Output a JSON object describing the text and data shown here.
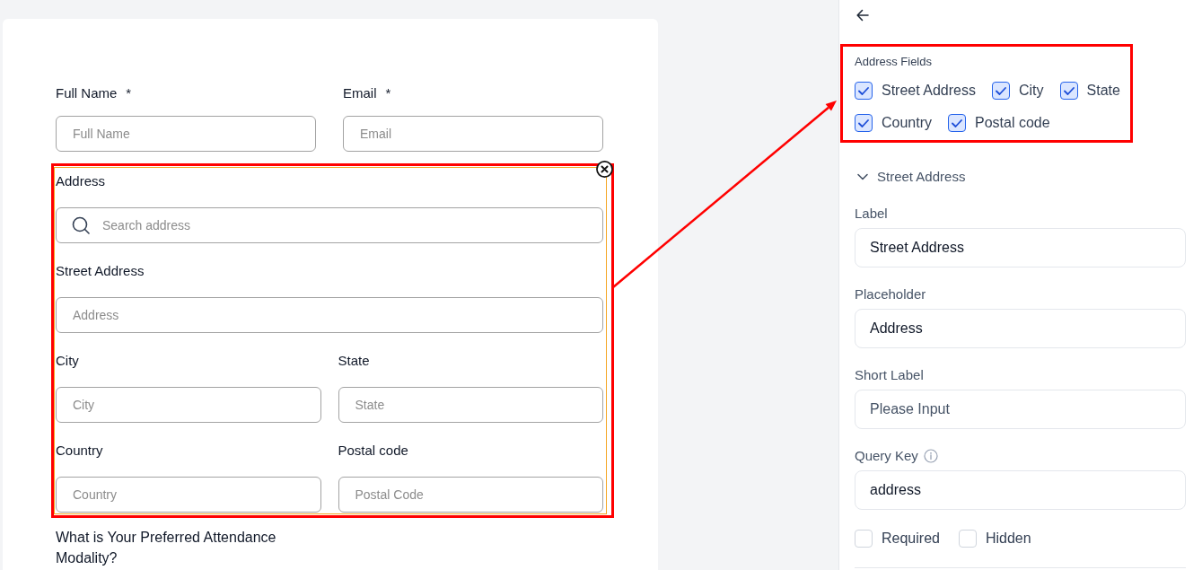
{
  "form": {
    "fields": [
      {
        "label": "Full Name",
        "mark": "*",
        "placeholder": "Full Name"
      },
      {
        "label": "Email",
        "mark": "*",
        "placeholder": "Email"
      }
    ],
    "address": {
      "selected": true,
      "title": "Address",
      "search": {
        "placeholder": "Search address"
      },
      "fields": [
        {
          "kind": "full",
          "label": "Street Address",
          "placeholder": "Address"
        },
        {
          "kind": "half",
          "label": "City",
          "placeholder": "City"
        },
        {
          "kind": "half",
          "label": "State",
          "placeholder": "State"
        },
        {
          "kind": "half",
          "label": "Country",
          "placeholder": "Country"
        },
        {
          "kind": "half",
          "label": "Postal code",
          "placeholder": "Postal Code"
        }
      ]
    },
    "question": {
      "label": "What is Your Preferred Attendance Modality?"
    }
  },
  "settings_panel": {
    "address_fields": {
      "title": "Address Fields",
      "items": [
        {
          "label": "Street Address",
          "checked": true
        },
        {
          "label": "City",
          "checked": true
        },
        {
          "label": "State",
          "checked": true
        },
        {
          "label": "Country",
          "checked": true
        },
        {
          "label": "Postal code",
          "checked": true
        }
      ]
    },
    "section": {
      "title": "Street Address",
      "expanded": true
    },
    "properties": [
      {
        "label": "Label",
        "info": false,
        "value": "Street Address"
      },
      {
        "label": "Placeholder",
        "info": false,
        "value": "Address"
      },
      {
        "label": "Short Label",
        "info": false,
        "placeholder": "Please Input"
      },
      {
        "label": "Query Key",
        "info": true,
        "value": "address"
      }
    ],
    "options": [
      {
        "label": "Required",
        "checked": false
      },
      {
        "label": "Hidden",
        "checked": false
      }
    ]
  }
}
